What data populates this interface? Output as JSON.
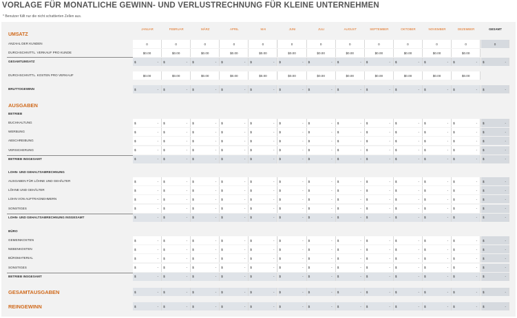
{
  "title": "VORLAGE FÜR MONATLICHE GEWINN- UND VERLUSTRECHNUNG FÜR KLEINE UNTERNEHMEN",
  "subtitle": "* Benutzer füllt nur die nicht schattierten Zellen aus.",
  "months": [
    "JANUAR",
    "FEBRUAR",
    "MÄRZ",
    "APRIL",
    "MAI",
    "JUNI",
    "JULI",
    "AUGUST",
    "SEPTEMBER",
    "OKTOBER",
    "NOVEMBER",
    "DEZEMBER"
  ],
  "total_header": "GESAMT",
  "currency_symbol": "$",
  "dash": "-",
  "zero": "0",
  "money_zero": "$0.00",
  "sections": {
    "umsatz": "UMSATZ",
    "ausgaben": "AUSGABEN",
    "gesamtausgaben": "GESAMTAUSGABEN",
    "reingewinn": "REINGEWINN"
  },
  "rows": {
    "anzahl_kunden": "ANZAHL DER KUNDEN",
    "durchschnitt_verkauf": "DURCHSCHNITTL. VERKAUF PRO KUNDE",
    "gesamtumsatz": "GESAMTUMSATZ",
    "durchschnitt_kosten": "DURCHSCHNITTL. KOSTEN PRO VERKAUF",
    "bruttogewinn": "BRUTTOGEWINN"
  },
  "groups": [
    {
      "heading": "BETRIEB",
      "items": [
        "BUCHHALTUNG",
        "WERBUNG",
        "ABSCHREIBUNG",
        "VERSICHERUNG"
      ],
      "total": "BETRIEB INSGESAMT"
    },
    {
      "heading": "LOHN- UND GEHALTSABRECHNUNG",
      "items": [
        "AUSGABEN FÜR LÖHNE UND GEHÄLTER",
        "LÖHNE UND GEHÄLTER",
        "LOHN VON AUFTRAGNEHMERN",
        "SONSTIGES"
      ],
      "total": "LOHN- UND GEHALTSABRECHNUNG INSGESAMT"
    },
    {
      "heading": "BÜRO",
      "items": [
        "GEMEINKOSTEN",
        "NEBENKOSTEN",
        "BÜROMATERIAL",
        "SONSTIGES"
      ],
      "total": "BETRIEB INSGESAMT"
    }
  ],
  "colors": {
    "accent": "#d06a1c",
    "shaded": "#dfe3e8",
    "input": "#ffffff",
    "background": "#f2f2f2"
  }
}
